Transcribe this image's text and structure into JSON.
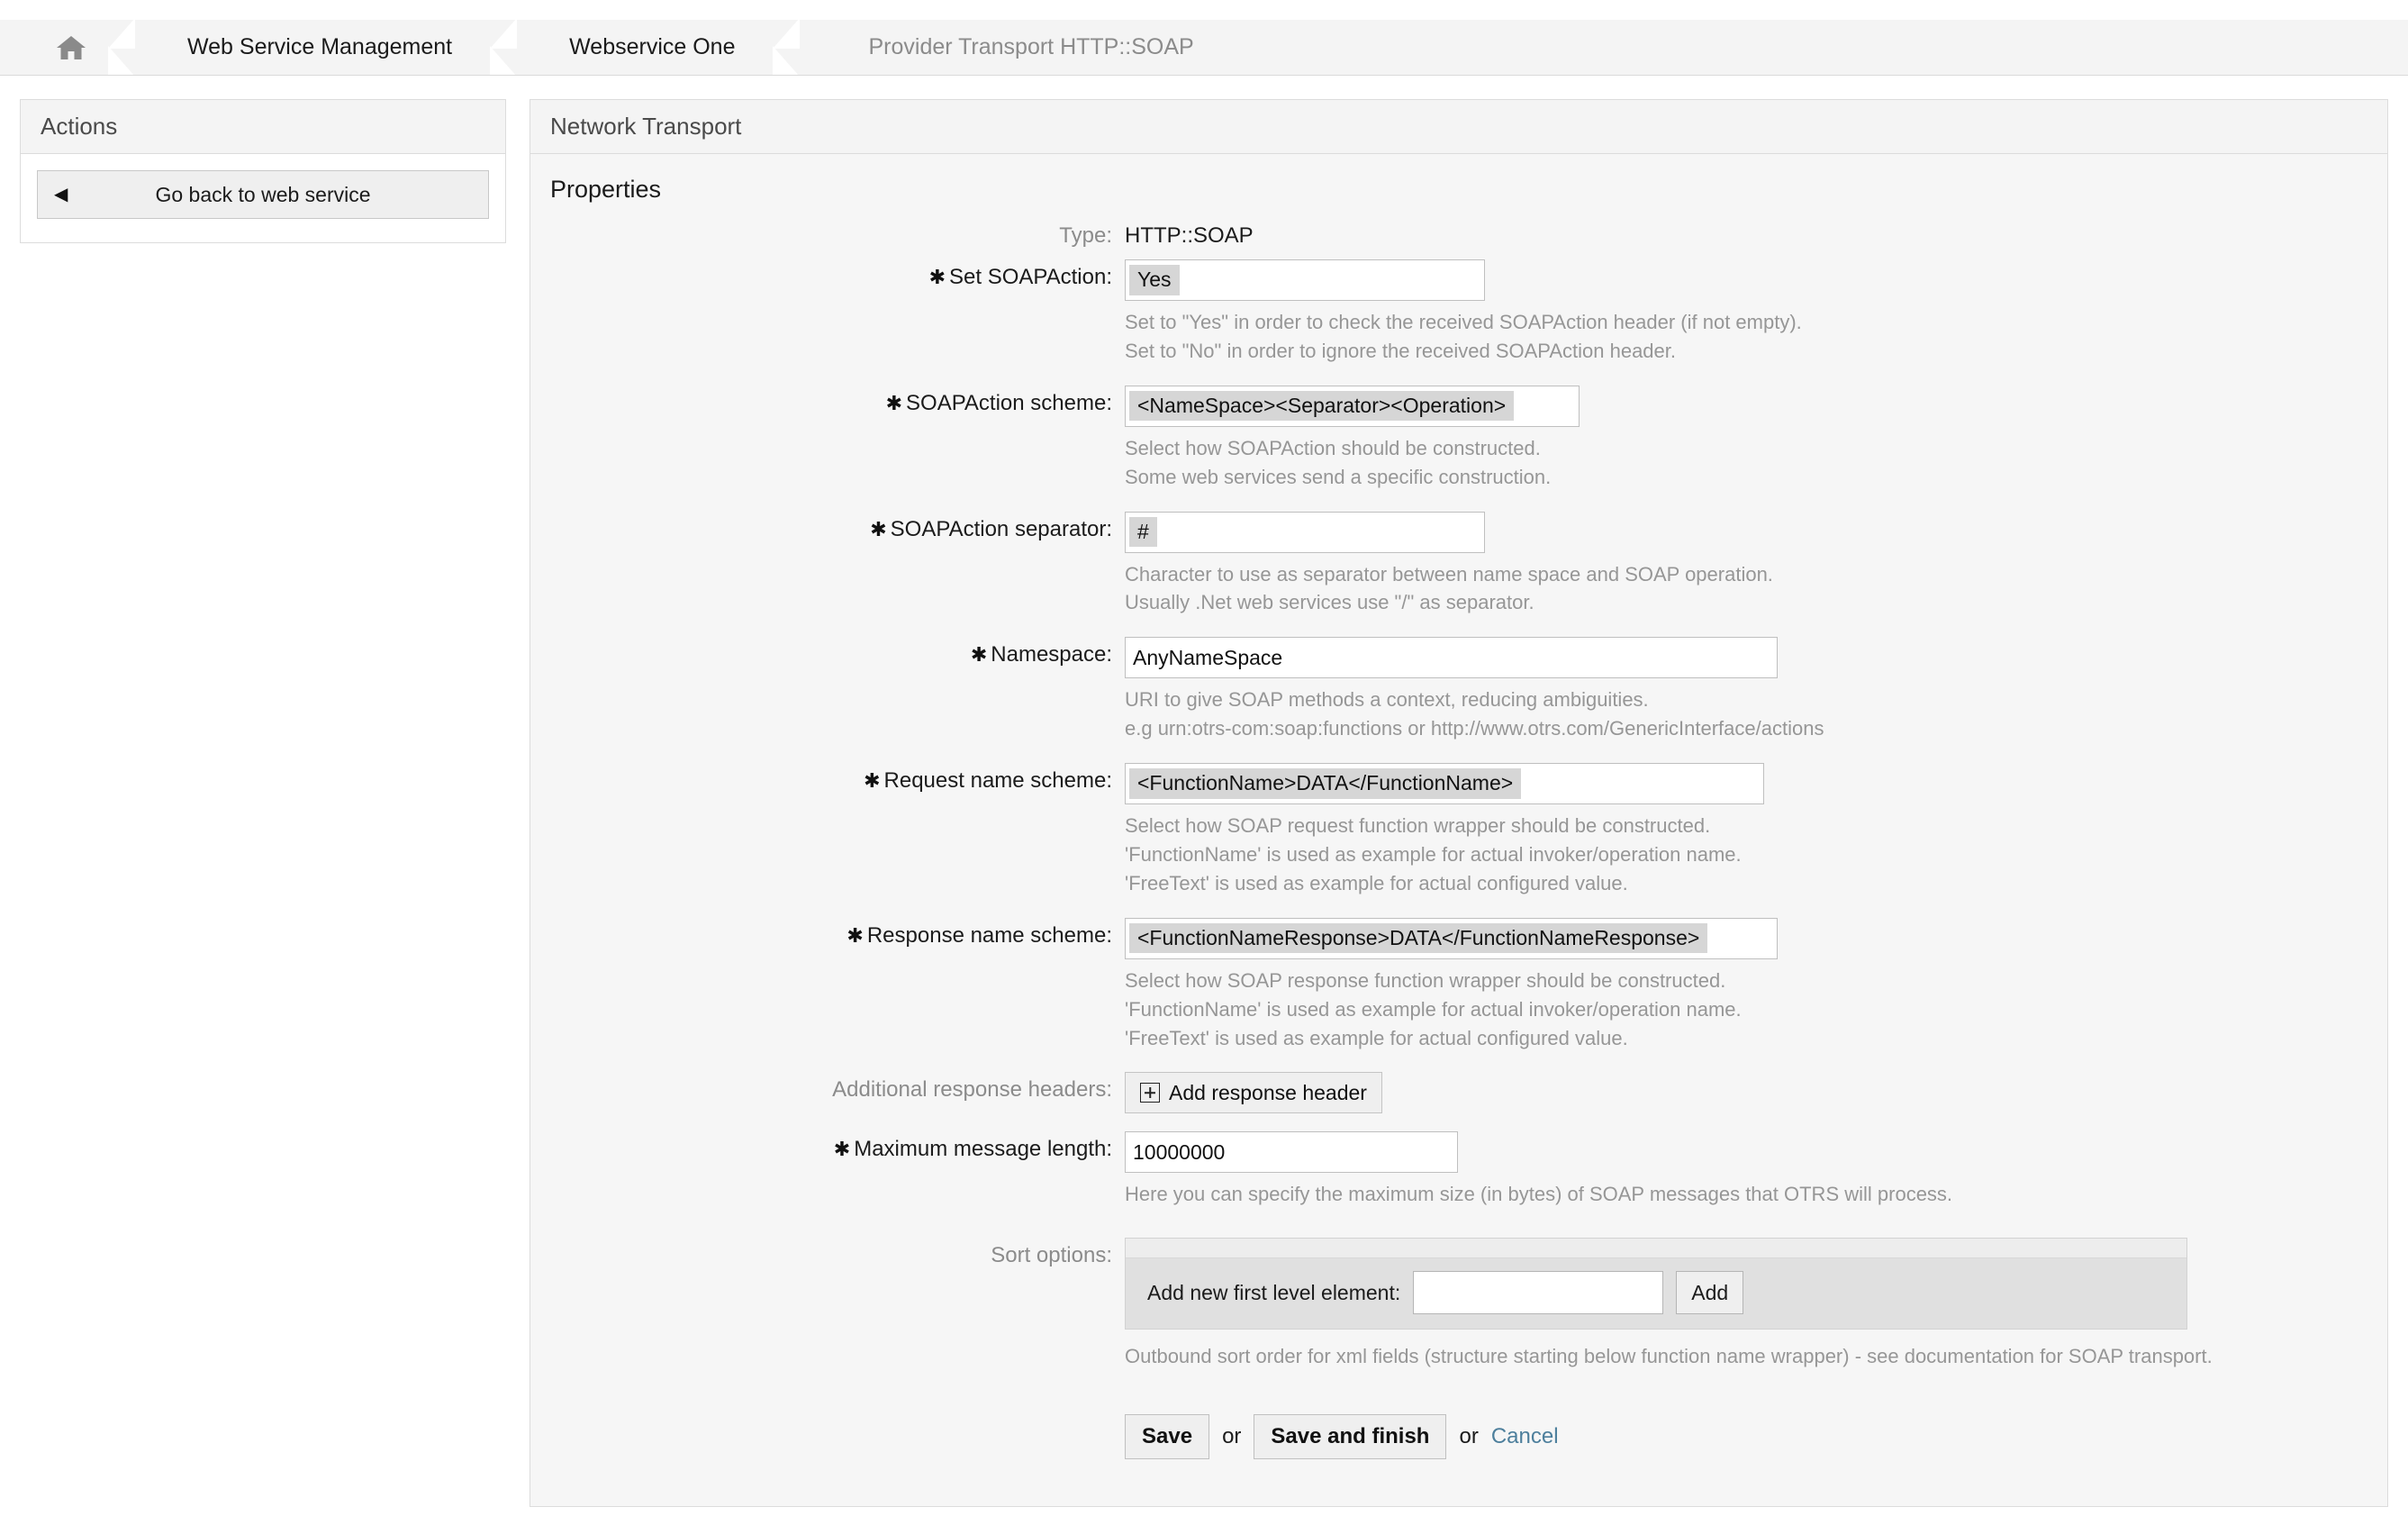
{
  "breadcrumb": {
    "home_icon": "home-icon",
    "items": [
      {
        "label": "Web Service Management",
        "current": false
      },
      {
        "label": "Webservice One",
        "current": false
      },
      {
        "label": "Provider Transport HTTP::SOAP",
        "current": true
      }
    ]
  },
  "sidebar": {
    "header": "Actions",
    "back_button": {
      "label": "Go back to web service",
      "icon": "triangle-left-icon"
    }
  },
  "content": {
    "header": "Network Transport",
    "section_title": "Properties"
  },
  "form": {
    "type": {
      "label": "Type:",
      "value": "HTTP::SOAP"
    },
    "set_soapaction": {
      "label": "Set SOAPAction:",
      "value": "Yes",
      "hint_line1": "Set to \"Yes\" in order to check the received SOAPAction header (if not empty).",
      "hint_line2": "Set to \"No\" in order to ignore the received SOAPAction header."
    },
    "soapaction_scheme": {
      "label": "SOAPAction scheme:",
      "value": "<NameSpace><Separator><Operation>",
      "hint_line1": "Select how SOAPAction should be constructed.",
      "hint_line2": "Some web services send a specific construction."
    },
    "soapaction_separator": {
      "label": "SOAPAction separator:",
      "value": "#",
      "hint_line1": "Character to use as separator between name space and SOAP operation.",
      "hint_line2": "Usually .Net web services use \"/\" as separator."
    },
    "namespace": {
      "label": "Namespace:",
      "value": "AnyNameSpace",
      "hint_line1": "URI to give SOAP methods a context, reducing ambiguities.",
      "hint_line2": "e.g urn:otrs-com:soap:functions or http://www.otrs.com/GenericInterface/actions"
    },
    "request_name_scheme": {
      "label": "Request name scheme:",
      "value": "<FunctionName>DATA</FunctionName>",
      "hint_line1": "Select how SOAP request function wrapper should be constructed.",
      "hint_line2": "'FunctionName' is used as example for actual invoker/operation name.",
      "hint_line3": "'FreeText' is used as example for actual configured value."
    },
    "response_name_scheme": {
      "label": "Response name scheme:",
      "value": "<FunctionNameResponse>DATA</FunctionNameResponse>",
      "hint_line1": "Select how SOAP response function wrapper should be constructed.",
      "hint_line2": "'FunctionName' is used as example for actual invoker/operation name.",
      "hint_line3": "'FreeText' is used as example for actual configured value."
    },
    "additional_response_headers": {
      "label": "Additional response headers:",
      "button_label": "Add response header"
    },
    "maximum_message_length": {
      "label": "Maximum message length:",
      "value": "10000000",
      "hint_line1": "Here you can specify the maximum size (in bytes) of SOAP messages that OTRS will process."
    },
    "sort_options": {
      "label": "Sort options:",
      "add_element_label": "Add new first level element:",
      "input_value": "",
      "add_button_label": "Add",
      "hint_line1": "Outbound sort order for xml fields (structure starting below function name wrapper) - see documentation for SOAP transport."
    }
  },
  "footer": {
    "save_label": "Save",
    "or_text_1": "or",
    "save_finish_label": "Save and finish",
    "or_text_2": "or",
    "cancel_label": "Cancel"
  },
  "colors": {
    "panel_bg": "#f6f6f6",
    "header_bg": "#f4f4f4",
    "border": "#dcdcdc",
    "hint_text": "#969696",
    "link": "#4d7f9c",
    "chip_bg": "#d6d6d6"
  }
}
